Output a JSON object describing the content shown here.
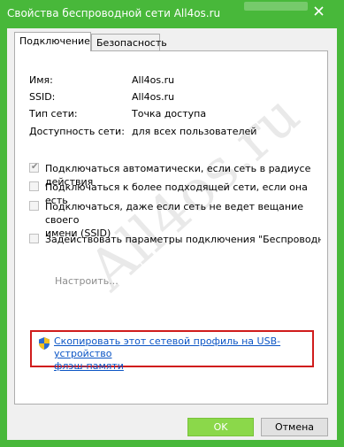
{
  "window": {
    "title": "Свойства беспроводной сети All4os.ru",
    "close_glyph": "✕"
  },
  "tabs": [
    {
      "label": "Подключение",
      "active": true
    },
    {
      "label": "Безопасность",
      "active": false
    }
  ],
  "info": {
    "name_label": "Имя:",
    "name_value": "All4os.ru",
    "ssid_label": "SSID:",
    "ssid_value": "All4os.ru",
    "type_label": "Тип сети:",
    "type_value": "Точка доступа",
    "availability_label": "Доступность сети:",
    "availability_value": "для всех пользователей"
  },
  "options": {
    "auto_connect": {
      "label": "Подключаться автоматически, если сеть в радиусе действия",
      "checked": true
    },
    "prefer_better": {
      "label": "Подключаться к более подходящей сети, если она есть",
      "checked": false
    },
    "hidden_ssid_line1": "Подключаться, даже если сеть не ведет вещание своего",
    "hidden_ssid_line2": "имени (SSID)",
    "intel_params": {
      "label": "Задействовать параметры подключения \"Беспроводная с",
      "checked": false
    }
  },
  "configure_label": "Настроить...",
  "watermark": "All4os.ru",
  "copy_profile": {
    "line1": "Скопировать этот сетевой профиль на USB-устройство",
    "line2": "флэш-памяти"
  },
  "buttons": {
    "ok": "OK",
    "cancel": "Отмена"
  },
  "colors": {
    "frame": "#48b83a",
    "ok_button": "#8bd84a",
    "highlight": "#d01c1c",
    "link": "#0b55c5"
  }
}
